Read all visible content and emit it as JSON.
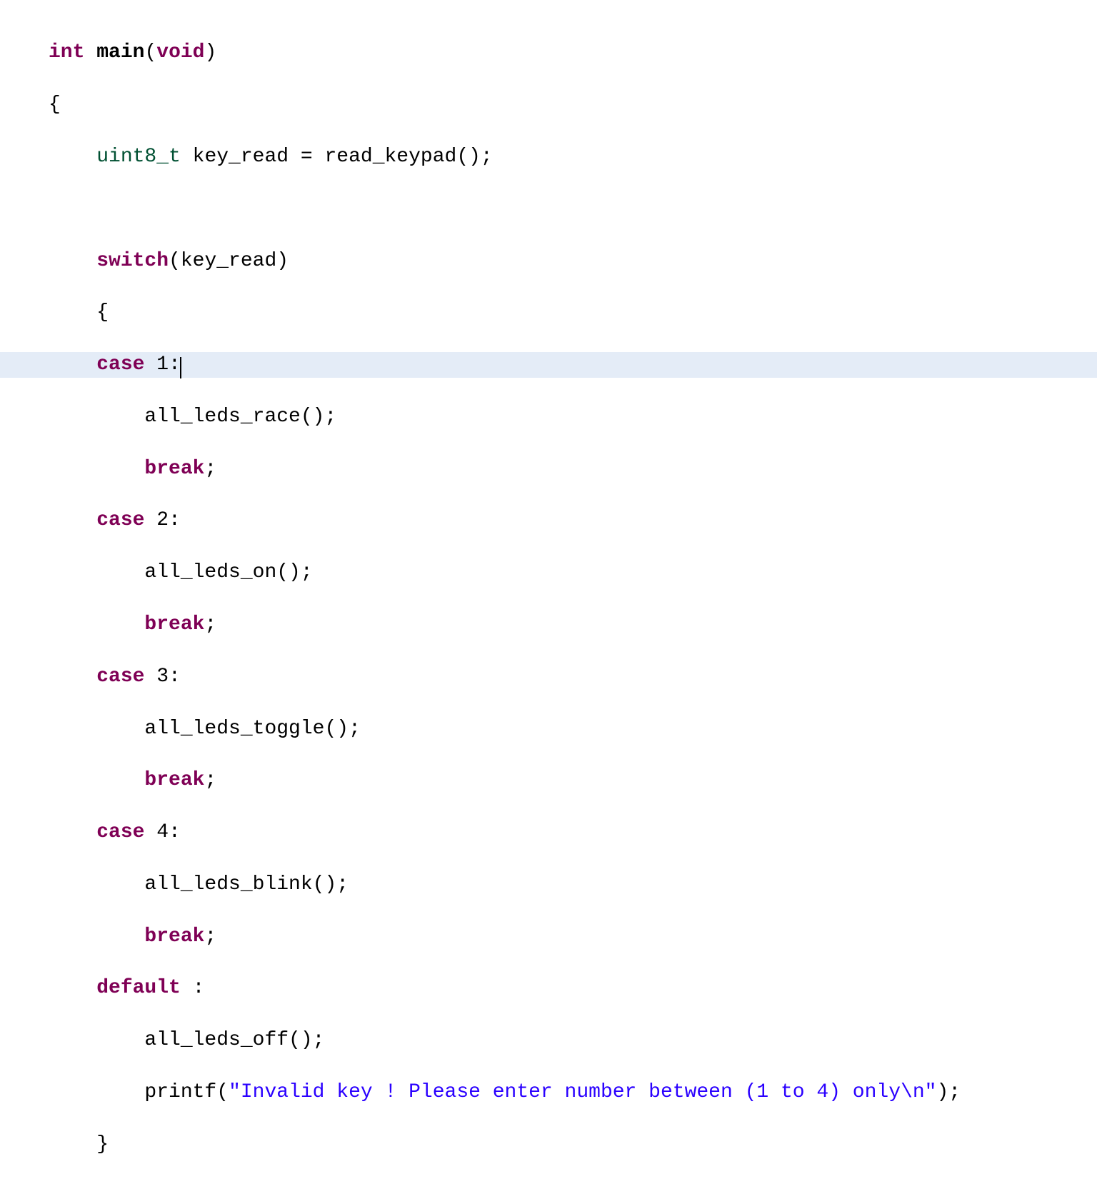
{
  "code": {
    "line1": {
      "kw_int": "int",
      "main": "main",
      "paren_open": "(",
      "kw_void": "void",
      "paren_close": ")"
    },
    "line2": {
      "brace_open": "{"
    },
    "line3": {
      "indent": "    ",
      "type_uint8": "uint8_t",
      "var": " key_read ",
      "eq": "=",
      "func": " read_keypad",
      "call": "();"
    },
    "line5": {
      "indent": "    ",
      "kw_switch": "switch",
      "arg": "(key_read)"
    },
    "line6": {
      "indent": "    ",
      "brace_open": "{"
    },
    "line7": {
      "indent": "    ",
      "kw_case": "case",
      "val": " 1:"
    },
    "line8": {
      "indent": "        ",
      "call": "all_leds_race();"
    },
    "line9": {
      "indent": "        ",
      "kw_break": "break",
      "semi": ";"
    },
    "line10": {
      "indent": "    ",
      "kw_case": "case",
      "val": " 2:"
    },
    "line11": {
      "indent": "        ",
      "call": "all_leds_on();"
    },
    "line12": {
      "indent": "        ",
      "kw_break": "break",
      "semi": ";"
    },
    "line13": {
      "indent": "    ",
      "kw_case": "case",
      "val": " 3:"
    },
    "line14": {
      "indent": "        ",
      "call": "all_leds_toggle();"
    },
    "line15": {
      "indent": "        ",
      "kw_break": "break",
      "semi": ";"
    },
    "line16": {
      "indent": "    ",
      "kw_case": "case",
      "val": " 4:"
    },
    "line17": {
      "indent": "        ",
      "call": "all_leds_blink();"
    },
    "line18": {
      "indent": "        ",
      "kw_break": "break",
      "semi": ";"
    },
    "line19": {
      "indent": "    ",
      "kw_default": "default",
      "colon": " :"
    },
    "line20": {
      "indent": "        ",
      "call": "all_leds_off();"
    },
    "line21": {
      "indent": "        ",
      "func": "printf",
      "paren_open": "(",
      "string": "\"Invalid key ! Please enter number between (1 to 4) only\\n\"",
      "paren_close": ");"
    },
    "line22": {
      "indent": "    ",
      "brace_close": "}"
    }
  }
}
